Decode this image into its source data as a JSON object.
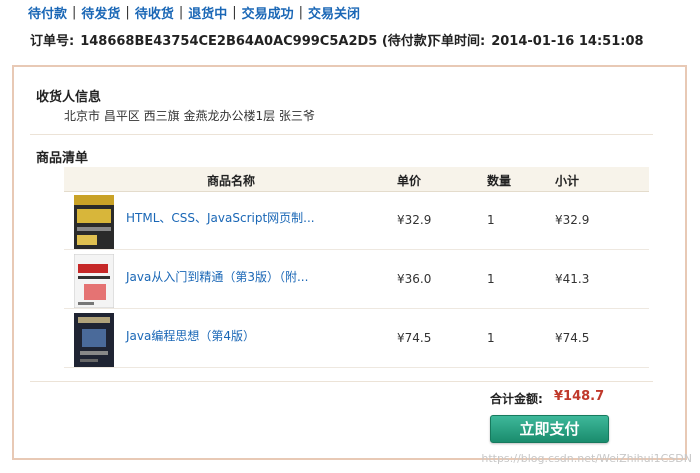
{
  "status_tabs": [
    "待付款",
    "待发货",
    "待收货",
    "退货中",
    "交易成功",
    "交易关闭"
  ],
  "tab_separator": "|",
  "order": {
    "label": "订单号:",
    "number": "148668BE43754CE2B64A0AC999C5A2D5 (待付款)",
    "time_label": "下单时间:",
    "time": "2014-01-16 14:51:08"
  },
  "recipient": {
    "title": "收货人信息",
    "address": "北京市 昌平区 西三旗 金燕龙办公楼1层 张三爷"
  },
  "product_list": {
    "title": "商品清单",
    "headers": {
      "name": "商品名称",
      "price": "单价",
      "qty": "数量",
      "subtotal": "小计"
    },
    "items": [
      {
        "name": "HTML、CSS、JavaScript网页制...",
        "price": "¥32.9",
        "qty": "1",
        "subtotal": "¥32.9"
      },
      {
        "name": "Java从入门到精通（第3版）（附...",
        "price": "¥36.0",
        "qty": "1",
        "subtotal": "¥41.3"
      },
      {
        "name": "Java编程思想（第4版）",
        "price": "¥74.5",
        "qty": "1",
        "subtotal": "¥74.5"
      }
    ]
  },
  "summary": {
    "total_label": "合计金额:",
    "total_value": "¥148.7"
  },
  "pay_button": "立即支付",
  "watermark": "https://blog.csdn.net/WeiZhihui1CSDN",
  "colors": {
    "link": "#1a67b6",
    "price_red": "#c0392b",
    "pay_green": "#1a8c6d",
    "panel_border": "#e8c9b5"
  }
}
